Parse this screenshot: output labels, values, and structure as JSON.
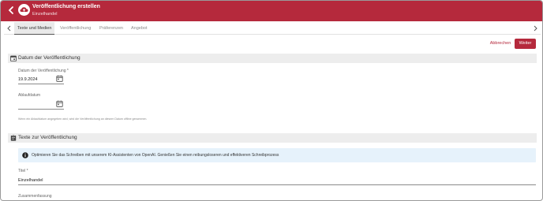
{
  "header": {
    "title": "Veröffentlichung erstellen",
    "subtitle": "Einzelhandel",
    "brand_color": "#b5293c",
    "back_icon": "chevron-left-icon",
    "logo_icon": "cloud-upload-icon"
  },
  "tabs": [
    {
      "label": "Texte und Medien",
      "active": true
    },
    {
      "label": "Veröffentlichung",
      "active": false
    },
    {
      "label": "Präferenzen",
      "active": false
    },
    {
      "label": "Angebot",
      "active": false
    }
  ],
  "actions": {
    "cancel_label": "Abbrechen",
    "next_label": "Weiter"
  },
  "section_date": {
    "title": "Datum der Veröffentlichung",
    "publish_date_label": "Datum der Veröffentlichung *",
    "publish_date_value": "19.9.2024",
    "expiry_date_label": "Ablaufdatum",
    "expiry_date_value": "",
    "hint": "Wenn ein Ablaufdatum angegeben wird, wird die Veröffentlichung an diesem Datum offline genommen."
  },
  "section_texts": {
    "title": "Texte zur Veröffentlichung",
    "info": "Optimieren Sie das Schreiben mit unserem KI-Assistenten von OpenAI. Genießen Sie einen reibungsloseren und effektiveren Schreibprozess",
    "title_field_label": "Titel *",
    "title_field_value": "Einzelhandel",
    "summary_label": "Zusammenfassung"
  }
}
